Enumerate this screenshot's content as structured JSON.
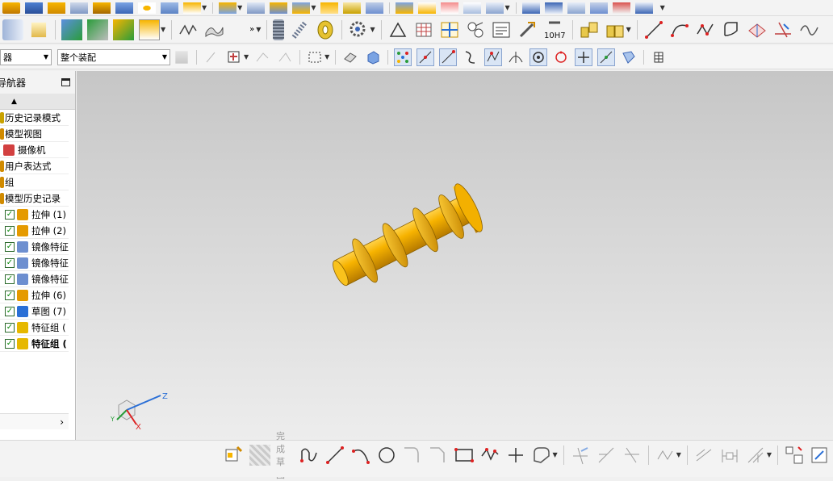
{
  "toolbar": {
    "selection_filter": "器",
    "assembly_scope": "整个装配",
    "tolerance_label": "10H7"
  },
  "navigator": {
    "title": "导航器",
    "items": [
      {
        "label": "历史记录模式",
        "kind": "mode"
      },
      {
        "label": "模型视图",
        "kind": "node"
      },
      {
        "label": "摄像机",
        "kind": "camera"
      },
      {
        "label": "用户表达式",
        "kind": "node"
      },
      {
        "label": "组",
        "kind": "node"
      },
      {
        "label": "模型历史记录",
        "kind": "node"
      },
      {
        "label": "拉伸 (1)",
        "kind": "extrude"
      },
      {
        "label": "拉伸 (2)",
        "kind": "extrude"
      },
      {
        "label": "镜像特征",
        "kind": "mirror"
      },
      {
        "label": "镜像特征",
        "kind": "mirror"
      },
      {
        "label": "镜像特征",
        "kind": "mirror"
      },
      {
        "label": "拉伸 (6)",
        "kind": "extrude"
      },
      {
        "label": "草图 (7)",
        "kind": "sketch"
      },
      {
        "label": "特征组 (",
        "kind": "group"
      },
      {
        "label": "特征组 (",
        "kind": "group",
        "bold": true
      }
    ]
  },
  "sketch_toolbar": {
    "finish_sketch": "完成草图"
  },
  "triad": {
    "z": "Z",
    "x": "X",
    "y": "Y"
  },
  "colors": {
    "part": "#f5b400",
    "part_edge": "#8a6000",
    "accent": "#2a6fd6"
  }
}
